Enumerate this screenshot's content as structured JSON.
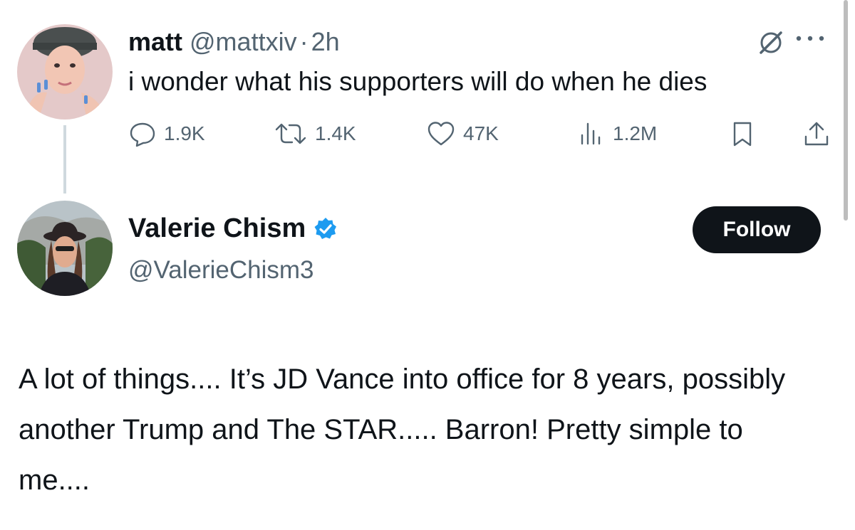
{
  "original_tweet": {
    "display_name": "matt",
    "handle": "@mattxiv",
    "separator": "·",
    "time": "2h",
    "text": "i wonder what his supporters will do when he dies",
    "stats": {
      "replies": "1.9K",
      "reposts": "1.4K",
      "likes": "47K",
      "views": "1.2M"
    }
  },
  "reply_author": {
    "display_name": "Valerie Chism",
    "handle": "@ValerieChism3",
    "verified": true,
    "verified_color": "#1d9bf0",
    "follow_label": "Follow"
  },
  "reply_text": "A lot of things....  It’s JD Vance into office for 8 years, possibly another Trump and The STAR..... Barron!  Pretty simple to me....",
  "icons": {
    "reply": "reply-icon",
    "repost": "repost-icon",
    "like": "like-icon",
    "views": "views-icon",
    "bookmark": "bookmark-icon",
    "share": "share-icon",
    "grok": "grok-icon",
    "more": "more-icon"
  },
  "colors": {
    "text": "#0f1419",
    "secondary": "#536471",
    "button_bg": "#0f1419"
  }
}
